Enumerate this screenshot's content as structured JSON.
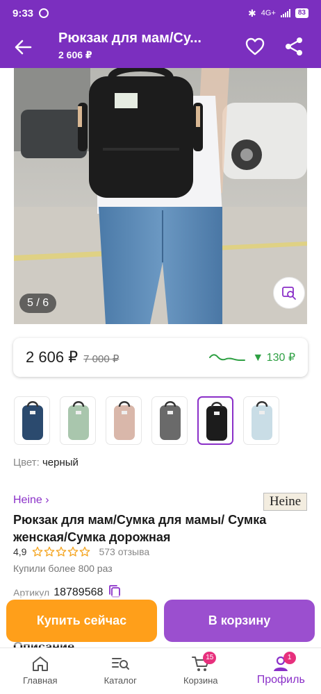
{
  "status_bar": {
    "time": "9:33",
    "network": "4G+",
    "battery": "83"
  },
  "header": {
    "title": "Рюкзак для мам/Су...",
    "price": "2 606 ₽"
  },
  "gallery": {
    "counter": "5 / 6"
  },
  "price_card": {
    "current": "2 606 ₽",
    "old": "7 000 ₽",
    "drop": "▼ 130 ₽"
  },
  "color": {
    "label": "Цвет:",
    "value": "черный"
  },
  "swatch_colors": [
    "#2b4a6e",
    "#a9c6ad",
    "#d9b7aa",
    "#6a6a6a",
    "#1c1c1c",
    "#c9dde6"
  ],
  "brand": {
    "link": "Heine ›",
    "logo": "Heine"
  },
  "product": {
    "title": "Рюкзак для мам/Сумка для мамы/ Сумка женская/Сумка дорожная",
    "rating": "4,9",
    "stars": 5,
    "reviews": "573 отзыва",
    "bought": "Купили более 800 раз",
    "sku_label": "Артикул",
    "sku_value": "18789568"
  },
  "section_heading": "Описание",
  "actions": {
    "buy_now": "Купить сейчас",
    "add_to_cart": "В корзину"
  },
  "nav": {
    "home": "Главная",
    "catalog": "Каталог",
    "cart": "Корзина",
    "cart_badge": "15",
    "profile": "Профиль",
    "profile_badge": "1"
  },
  "colors": {
    "brand": "#7b2fbf",
    "accent": "#8a2fc8",
    "buy": "#ff9f1a",
    "cart": "#9b4fcf",
    "price_drop": "#2ea043",
    "star": "#f4a623"
  }
}
